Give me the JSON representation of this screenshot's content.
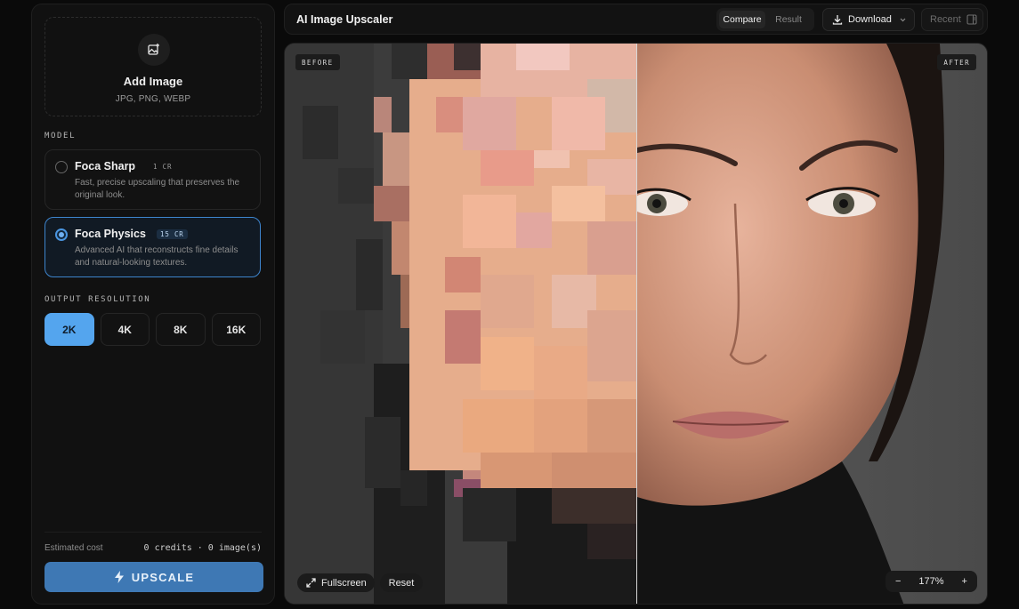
{
  "sidebar": {
    "upload": {
      "title": "Add Image",
      "formats": "JPG, PNG, WEBP",
      "icon": "image-add-icon"
    },
    "model_label": "MODEL",
    "models": [
      {
        "name": "Foca Sharp",
        "badge": "1 CR",
        "description": "Fast, precise upscaling that preserves the original look.",
        "selected": false
      },
      {
        "name": "Foca Physics",
        "badge": "15 CR",
        "description": "Advanced AI that reconstructs fine details and natural-looking textures.",
        "selected": true
      }
    ],
    "resolution_label": "OUTPUT RESOLUTION",
    "resolutions": [
      "2K",
      "4K",
      "8K",
      "16K"
    ],
    "selected_resolution": "2K",
    "estimated_cost_label": "Estimated cost",
    "estimated_cost_value": "0 credits · 0 image(s)",
    "upscale_label": "UPSCALE",
    "upscale_icon": "lightning-icon"
  },
  "header": {
    "title": "AI Image Upscaler",
    "view_modes": [
      "Compare",
      "Result"
    ],
    "active_view": "Compare",
    "download_label": "Download",
    "recent_label": "Recent"
  },
  "viewer": {
    "before_label": "BEFORE",
    "after_label": "AFTER",
    "split_position": 0.5,
    "fullscreen_label": "Fullscreen",
    "reset_label": "Reset",
    "zoom_out": "−",
    "zoom_level": "177%",
    "zoom_in": "+"
  },
  "colors": {
    "accent": "#54a5ee",
    "upscale_button": "#3e78b4",
    "background": "#0a0a0a",
    "panel": "#111111"
  }
}
